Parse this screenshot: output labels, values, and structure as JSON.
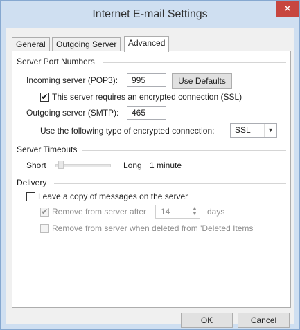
{
  "window": {
    "title": "Internet E-mail Settings",
    "close_glyph": "✕"
  },
  "tabs": [
    {
      "label": "General",
      "active": false
    },
    {
      "label": "Outgoing Server",
      "active": false
    },
    {
      "label": "Advanced",
      "active": true
    }
  ],
  "server_ports": {
    "group_label": "Server Port Numbers",
    "incoming_label": "Incoming server (POP3):",
    "incoming_value": "995",
    "use_defaults_label": "Use Defaults",
    "ssl_required_label": "This server requires an encrypted connection (SSL)",
    "ssl_required_checked": true,
    "outgoing_label": "Outgoing server (SMTP):",
    "outgoing_value": "465",
    "encryption_label": "Use the following type of encrypted connection:",
    "encryption_value": "SSL"
  },
  "timeouts": {
    "group_label": "Server Timeouts",
    "short_label": "Short",
    "long_label": "Long",
    "value_label": "1 minute",
    "slider_level": 0.05
  },
  "delivery": {
    "group_label": "Delivery",
    "leave_copy_label": "Leave a copy of messages on the server",
    "leave_copy_checked": false,
    "remove_after_label": "Remove from server after",
    "remove_after_checked": true,
    "remove_after_days": "14",
    "days_label": "days",
    "remove_deleted_label": "Remove from server when deleted from 'Deleted Items'",
    "remove_deleted_checked": false
  },
  "footer": {
    "ok_label": "OK",
    "cancel_label": "Cancel"
  },
  "icons": {
    "check": "✔",
    "combo_arrow": "▼",
    "spin_up": "▲",
    "spin_down": "▼"
  },
  "colors": {
    "titlebar": "#cfdff1",
    "close_button": "#c7463f",
    "dialog": "#f0f0f0"
  }
}
